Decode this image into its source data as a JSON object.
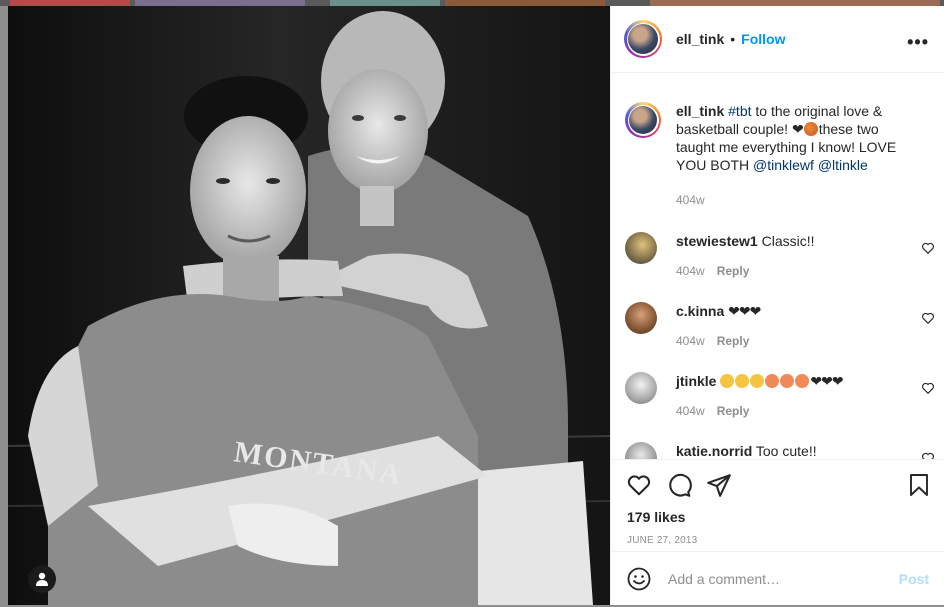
{
  "post": {
    "author": "ell_tink",
    "separator": "•",
    "follow_label": "Follow",
    "more_icon": "more-horizontal-icon",
    "caption": {
      "username": "ell_tink",
      "hashtag": "#tbt",
      "text_1": " to the original love & basketball couple! ",
      "text_2": "these two taught me everything I know! LOVE YOU BOTH ",
      "mention_1": "@tinklewf",
      "mention_2": "@ltinkle",
      "age": "404w"
    },
    "photo_text": "MONTANA",
    "comments": [
      {
        "username": "stewiestew1",
        "text": "Classic!!",
        "age": "404w",
        "reply_label": "Reply"
      },
      {
        "username": "c.kinna",
        "text": "❤❤❤",
        "age": "404w",
        "reply_label": "Reply"
      },
      {
        "username": "jtinkle",
        "text": "❤❤❤",
        "age": "404w",
        "reply_label": "Reply"
      },
      {
        "username": "katie.norrid",
        "text": "Too cute!!"
      }
    ],
    "likes": "179 likes",
    "date": "JUNE 27, 2013",
    "comment_placeholder": "Add a comment…",
    "post_label": "Post",
    "colors": {
      "link": "#00376b",
      "follow": "#0095f6",
      "post_disabled": "#b2dffc",
      "muted": "#8e8e8e"
    }
  }
}
